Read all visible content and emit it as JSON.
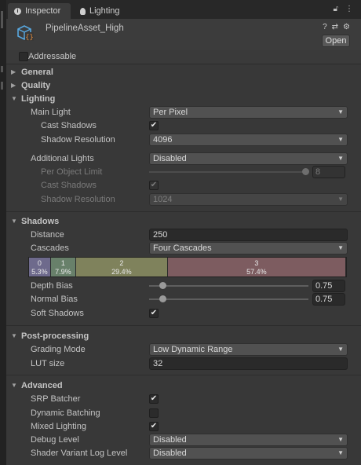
{
  "tabs": [
    {
      "label": "Inspector",
      "icon": "info-icon"
    },
    {
      "label": "Lighting",
      "icon": "bulb-icon"
    }
  ],
  "asset": {
    "title": "PipelineAsset_High",
    "open_label": "Open"
  },
  "addressable": {
    "label": "Addressable",
    "checked": false
  },
  "sections": {
    "general": "General",
    "quality": "Quality",
    "lighting": "Lighting",
    "shadows": "Shadows",
    "post": "Post-processing",
    "advanced": "Advanced"
  },
  "lighting": {
    "main_light_label": "Main Light",
    "main_light_value": "Per Pixel",
    "cast_shadows_label": "Cast Shadows",
    "shadow_res_label": "Shadow Resolution",
    "shadow_res_value": "4096",
    "additional_lights_label": "Additional Lights",
    "additional_lights_value": "Disabled",
    "per_object_limit_label": "Per Object Limit",
    "per_object_limit_value": "8",
    "add_cast_shadows_label": "Cast Shadows",
    "add_shadow_res_label": "Shadow Resolution",
    "add_shadow_res_value": "1024"
  },
  "shadows": {
    "distance_label": "Distance",
    "distance_value": "250",
    "cascades_label": "Cascades",
    "cascades_value": "Four Cascades",
    "cascade_splits": [
      {
        "index": "0",
        "pct": "5.3%",
        "color": "#6e6a8c"
      },
      {
        "index": "1",
        "pct": "7.9%",
        "color": "#68806a"
      },
      {
        "index": "2",
        "pct": "29.4%",
        "color": "#7f825c"
      },
      {
        "index": "3",
        "pct": "57.4%",
        "color": "#7d5c60"
      }
    ],
    "depth_bias_label": "Depth Bias",
    "depth_bias_value": "0.75",
    "normal_bias_label": "Normal Bias",
    "normal_bias_value": "0.75",
    "soft_shadows_label": "Soft Shadows"
  },
  "post": {
    "grading_mode_label": "Grading Mode",
    "grading_mode_value": "Low Dynamic Range",
    "lut_size_label": "LUT size",
    "lut_size_value": "32"
  },
  "advanced": {
    "srp_batcher_label": "SRP Batcher",
    "dynamic_batching_label": "Dynamic Batching",
    "mixed_lighting_label": "Mixed Lighting",
    "debug_level_label": "Debug Level",
    "debug_level_value": "Disabled",
    "shader_variant_label": "Shader Variant Log Level",
    "shader_variant_value": "Disabled"
  },
  "checkmark": "✔",
  "colors": {
    "panel": "#383838",
    "tabbar": "#282828",
    "field": "#2a2a2a"
  }
}
